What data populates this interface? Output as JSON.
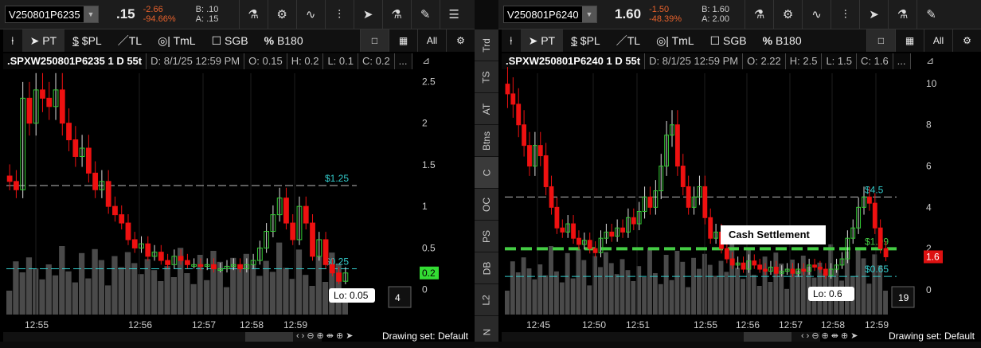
{
  "left": {
    "symbol": "V250801P6235",
    "last": ".15",
    "change": "-2.66",
    "change_pct": "-94.66%",
    "bid": "B: .10",
    "ask": "A: .15",
    "tools": [
      "PT",
      "$PL",
      "TL",
      "TmL",
      "SGB",
      "B180"
    ],
    "info": {
      "title": ".SPXW250801P6235 1 D 55t",
      "date": "D: 8/1/25 12:59 PM",
      "open": "O: 0.15",
      "high": "H: 0.2",
      "low": "L: 0.1",
      "close": "C: 0.2",
      "more": "..."
    },
    "drawing_set": "Drawing set: Default"
  },
  "right": {
    "symbol": "V250801P6240",
    "last": "1.60",
    "change": "-1.50",
    "change_pct": "-48.39%",
    "bid": "B: 1.60",
    "ask": "A: 2.00",
    "tools": [
      "PT",
      "$PL",
      "TL",
      "TmL",
      "SGB",
      "B180"
    ],
    "info": {
      "title": ".SPXW250801P6240 1 D 55t",
      "date": "D: 8/1/25 12:59 PM",
      "open": "O: 2.22",
      "high": "H: 2.5",
      "low": "L: 1.5",
      "close": "C: 1.6",
      "more": "..."
    },
    "drawing_set": "Drawing set: Default"
  },
  "side_tabs": [
    "Trd",
    "TS",
    "AT",
    "Btns",
    "C",
    "OC",
    "PS",
    "DB",
    "L2",
    "N"
  ],
  "colors": {
    "up": "#33cc33",
    "down": "#ee1111",
    "cyan": "#33cccc",
    "green_line": "#44cc44"
  },
  "chart_data": [
    {
      "type": "candlestick",
      "name": ".SPXW250801P6235",
      "ylim": [
        -0.3,
        2.6
      ],
      "yticks": [
        "2.5",
        "2",
        "1.5",
        "1",
        "0.5",
        "0"
      ],
      "ytick_values": [
        2.5,
        2,
        1.5,
        1,
        0.5,
        0
      ],
      "xticks": [
        "12:55",
        "12:56",
        "12:57",
        "12:58",
        "12:59"
      ],
      "closes": [
        1.3,
        1.2,
        2.3,
        2.0,
        2.4,
        2.3,
        2.2,
        2.4,
        2.0,
        1.8,
        1.6,
        1.7,
        1.4,
        1.2,
        1.3,
        1.0,
        0.9,
        0.8,
        0.6,
        0.5,
        0.55,
        0.4,
        0.45,
        0.35,
        0.3,
        0.4,
        0.35,
        0.3,
        0.3,
        0.28,
        0.3,
        0.25,
        0.25,
        0.28,
        0.3,
        0.25,
        0.3,
        0.35,
        0.5,
        0.7,
        0.9,
        1.1,
        0.8,
        0.6,
        1.0,
        0.8,
        0.4,
        0.6,
        0.3,
        0.2,
        0.1,
        0.2
      ],
      "lines": [
        {
          "label": "$1.25",
          "value": 1.25
        },
        {
          "label": "$0.25",
          "value": 0.25
        }
      ],
      "last_label": "0.2",
      "low_label": "Lo: 0.05",
      "count_label": "4"
    },
    {
      "type": "candlestick",
      "name": ".SPXW250801P6240",
      "ylim": [
        -1.2,
        10.5
      ],
      "yticks": [
        "10",
        "8",
        "6",
        "4",
        "2",
        "0"
      ],
      "ytick_values": [
        10,
        8,
        6,
        4,
        2,
        0
      ],
      "xticks": [
        "12:45",
        "12:50",
        "12:51",
        "12:55",
        "12:56",
        "12:57",
        "12:58",
        "12:59"
      ],
      "closes": [
        9.5,
        9,
        8,
        7,
        6,
        7,
        6.5,
        5,
        4,
        3,
        2.8,
        3.2,
        2.5,
        2.2,
        2.4,
        2.0,
        1.8,
        2.5,
        2.8,
        2.6,
        3,
        2.8,
        3.5,
        3.2,
        3.8,
        4.5,
        4,
        4.8,
        6,
        7.5,
        8,
        6,
        5,
        4,
        4.5,
        5,
        3.5,
        2.5,
        2.8,
        2.0,
        1.5,
        1.2,
        1.3,
        1.0,
        1.4,
        1.2,
        1.0,
        0.9,
        1.1,
        0.8,
        0.9,
        1.0,
        0.8,
        1.0,
        0.9,
        1.2,
        1.1,
        1.0,
        0.7,
        1.0,
        1.2,
        1.5,
        2.5,
        3,
        4,
        4.5,
        4.2,
        3,
        2,
        1.6
      ],
      "lines": [
        {
          "label": "$4.5",
          "value": 4.5
        },
        {
          "label": "$1.99",
          "value": 1.99,
          "style": "green-dashed"
        },
        {
          "label": "$0.65",
          "value": 0.65
        }
      ],
      "annotation": "Cash Settlement",
      "last_label": "1.6",
      "low_label": "Lo: 0.6",
      "count_label": "19"
    }
  ]
}
